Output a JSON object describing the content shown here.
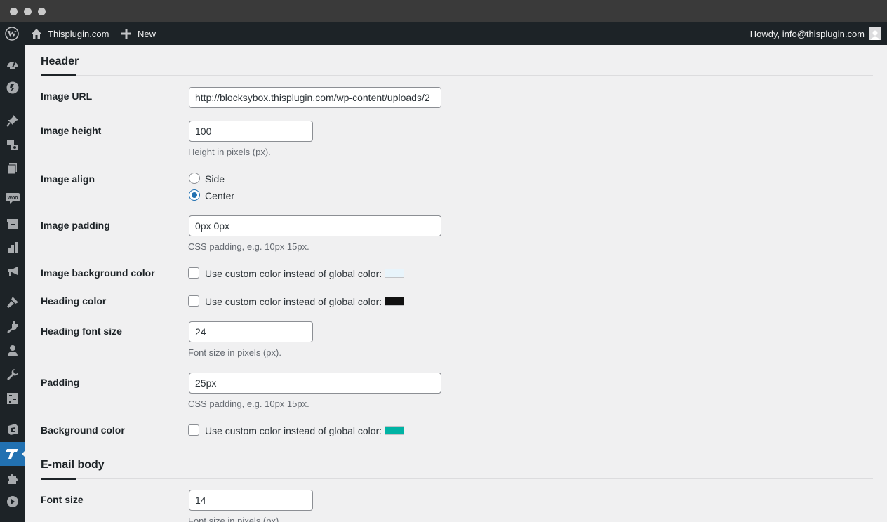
{
  "adminbar": {
    "site_name": "Thisplugin.com",
    "new_label": "New",
    "howdy": "Howdy, info@thisplugin.com"
  },
  "sections": {
    "header": {
      "title": "Header"
    },
    "email_body": {
      "title": "E-mail body"
    }
  },
  "fields": {
    "image_url": {
      "label": "Image URL",
      "value": "http://blocksybox.thisplugin.com/wp-content/uploads/2"
    },
    "image_height": {
      "label": "Image height",
      "value": "100",
      "description": "Height in pixels (px)."
    },
    "image_align": {
      "label": "Image align",
      "options": [
        "Side",
        "Center"
      ],
      "selected": "Center"
    },
    "image_padding": {
      "label": "Image padding",
      "value": "0px 0px",
      "description": "CSS padding, e.g. 10px 15px."
    },
    "image_background_color": {
      "label": "Image background color",
      "checkbox_label": "Use custom color instead of global color:",
      "checked": false,
      "color": "#e8f4fb"
    },
    "heading_color": {
      "label": "Heading color",
      "checkbox_label": "Use custom color instead of global color:",
      "checked": false,
      "color": "#111111"
    },
    "heading_font_size": {
      "label": "Heading font size",
      "value": "24",
      "description": "Font size in pixels (px)."
    },
    "padding": {
      "label": "Padding",
      "value": "25px",
      "description": "CSS padding, e.g. 10px 15px."
    },
    "background_color": {
      "label": "Background color",
      "checkbox_label": "Use custom color instead of global color:",
      "checked": false,
      "color": "#00b3a4"
    },
    "font_size": {
      "label": "Font size",
      "value": "14",
      "description": "Font size in pixels (px)."
    }
  },
  "colors": {
    "accent": "#2271b1",
    "adminbar": "#1d2327"
  }
}
